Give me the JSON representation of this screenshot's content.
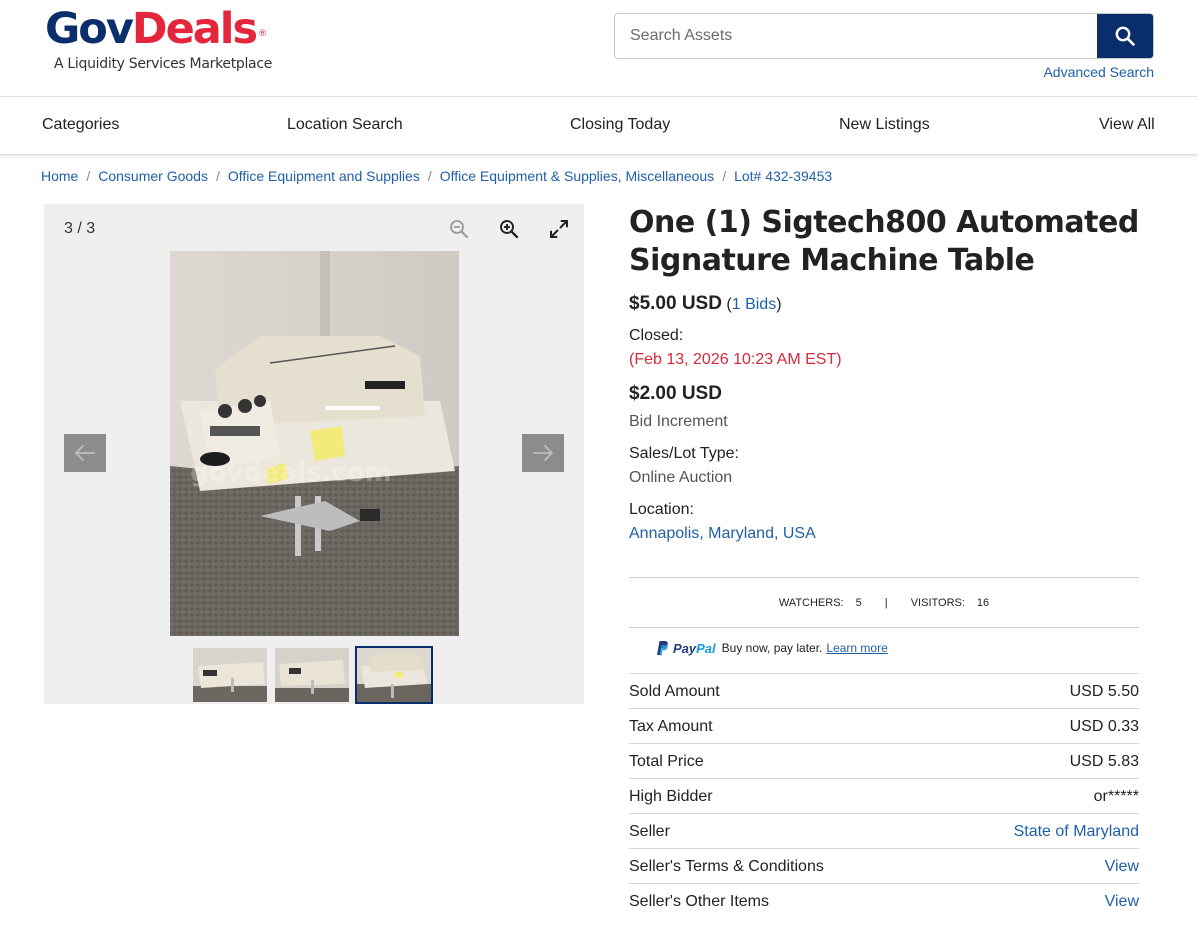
{
  "header": {
    "logo_gov": "Gov",
    "logo_deals": "Deals",
    "logo_reg": "®",
    "logo_tagline": "A Liquidity Services Marketplace",
    "search_placeholder": "Search Assets",
    "search_icon": "search-icon",
    "advanced_search": "Advanced Search",
    "brand_navy": "#0a2d6b",
    "brand_red": "#e3263b"
  },
  "nav": {
    "items": [
      "Categories",
      "Location Search",
      "Closing Today",
      "New Listings",
      "View All"
    ]
  },
  "breadcrumb": [
    "Home",
    "Consumer Goods",
    "Office Equipment and Supplies",
    "Office Equipment & Supplies, Miscellaneous",
    "Lot# 432-39453"
  ],
  "gallery": {
    "counter": "3 / 3",
    "current_image": 3,
    "total_images": 3,
    "tools": [
      "zoom-out-icon",
      "zoom-in-icon",
      "fullscreen-icon"
    ],
    "prev_icon": "arrow-left-icon",
    "next_icon": "arrow-right-icon",
    "watermark": "govdeals.com"
  },
  "listing": {
    "title": "One (1) Sigtech800 Automated Signature Machine Table",
    "current_price": "$5.00 USD",
    "bids_open": " (",
    "bids_link": "1 Bids",
    "bids_close": ")",
    "closed_label": "Closed:",
    "closed_value": "(Feb 13, 2026 10:23 AM EST)",
    "bid_increment_value": "$2.00 USD",
    "bid_increment_label": "Bid Increment",
    "sales_type_label": "Sales/Lot Type:",
    "sales_type_value": "Online Auction",
    "location_label": "Location:",
    "location_value": "Annapolis, Maryland, USA"
  },
  "stats": {
    "watchers_label": "WATCHERS:",
    "watchers_value": "5",
    "separator": "|",
    "visitors_label": "VISITORS:",
    "visitors_value": "16"
  },
  "paypal": {
    "pay": "Pay",
    "pal": "Pal",
    "text": "Buy now, pay later.",
    "learn_more": "Learn more"
  },
  "summary": {
    "sold_amount_label": "Sold Amount",
    "sold_amount_value": "USD 5.50",
    "tax_amount_label": "Tax Amount",
    "tax_amount_value": "USD 0.33",
    "total_price_label": "Total Price",
    "total_price_value": "USD 5.83",
    "high_bidder_label": "High Bidder",
    "high_bidder_value": "or*****",
    "seller_label": "Seller",
    "seller_value": "State of Maryland",
    "terms_label": "Seller's Terms & Conditions",
    "terms_value": "View",
    "other_items_label": "Seller's Other Items",
    "other_items_value": "View"
  }
}
